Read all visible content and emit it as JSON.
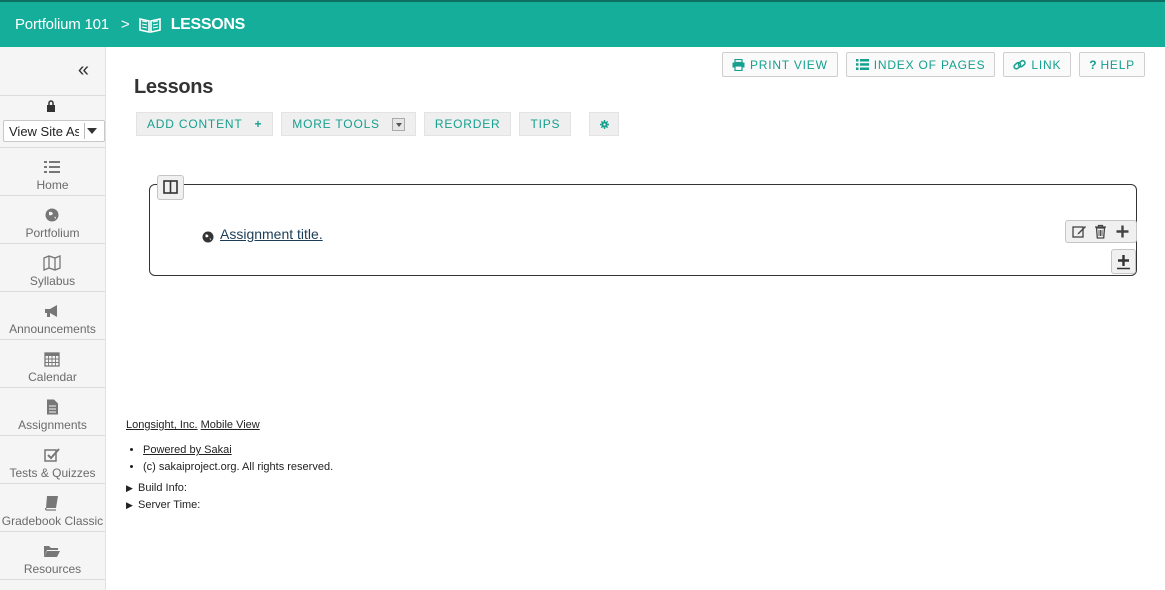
{
  "header": {
    "site_title": "Portfolium 101",
    "separator": ">",
    "current_tool": "LESSONS",
    "current_tool_icon": "open-book-icon"
  },
  "sidebar": {
    "collapse_glyph": "«",
    "view_as": {
      "icon": "lock-icon",
      "selected": "View Site As"
    },
    "items": [
      {
        "label": "Home",
        "icon": "list-icon"
      },
      {
        "label": "Portfolium",
        "icon": "globe-icon"
      },
      {
        "label": "Syllabus",
        "icon": "map-icon"
      },
      {
        "label": "Announcements",
        "icon": "bullhorn-icon"
      },
      {
        "label": "Calendar",
        "icon": "calendar-icon"
      },
      {
        "label": "Assignments",
        "icon": "document-icon"
      },
      {
        "label": "Tests & Quizzes",
        "icon": "checkbox-icon"
      },
      {
        "label": "Gradebook Classic",
        "icon": "book-icon"
      },
      {
        "label": "Resources",
        "icon": "folder-icon"
      }
    ]
  },
  "main": {
    "title": "Lessons",
    "top_buttons": [
      {
        "label": "PRINT VIEW",
        "icon": "printer-icon"
      },
      {
        "label": "INDEX OF PAGES",
        "icon": "list-icon"
      },
      {
        "label": "LINK",
        "icon": "link-icon"
      },
      {
        "label": "HELP",
        "icon": "question-icon"
      }
    ],
    "toolbar": {
      "add_content": "ADD CONTENT",
      "more_tools": "MORE TOOLS",
      "reorder": "REORDER",
      "tips": "TIPS"
    },
    "section": {
      "item_link": "Assignment title.",
      "item_icon": "globe-icon"
    }
  },
  "footer": {
    "links": [
      "Longsight, Inc.",
      "Mobile View"
    ],
    "list": [
      "Powered by Sakai",
      "(c) sakaiproject.org. All rights reserved."
    ],
    "expanders": [
      "Build Info:",
      "Server Time:"
    ]
  },
  "colors": {
    "accent": "#15ae9b",
    "accent_text": "#15a08f"
  }
}
